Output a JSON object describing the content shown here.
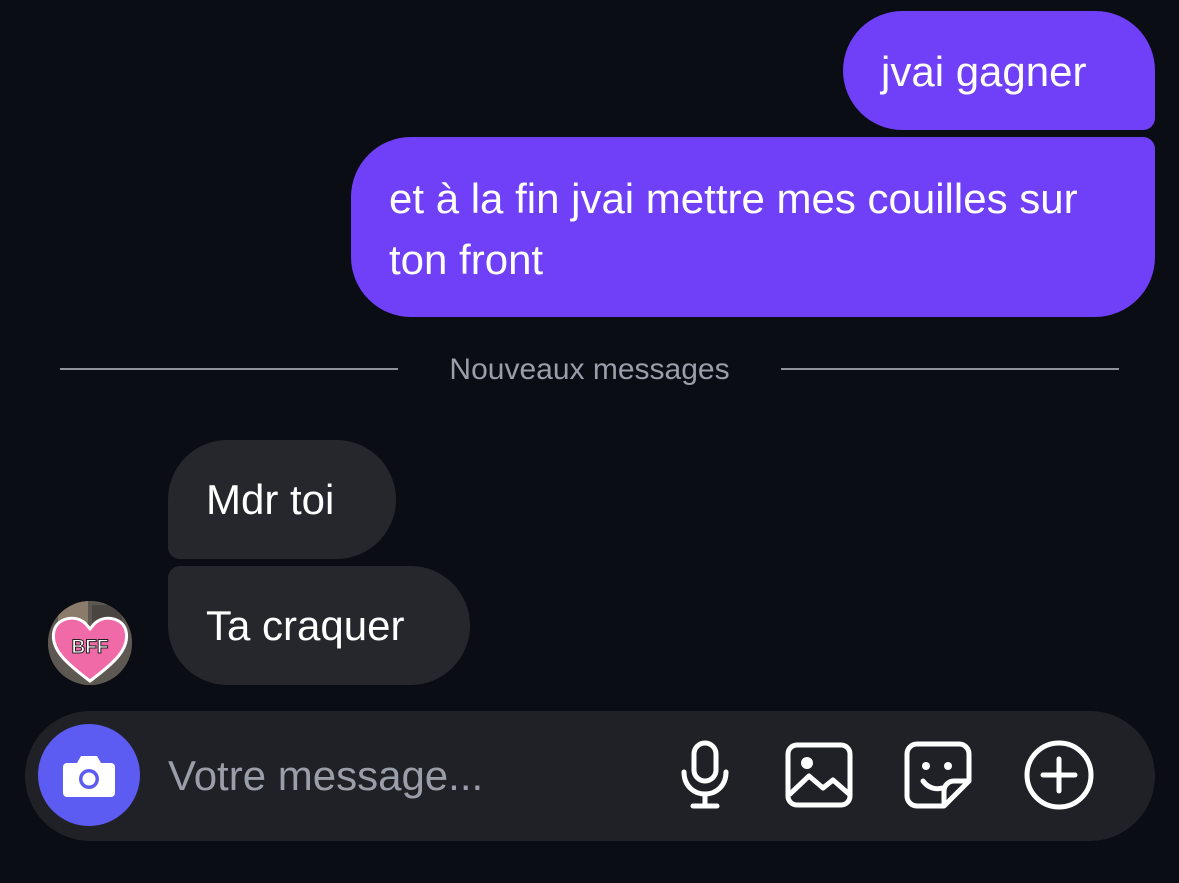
{
  "messages": {
    "sent": [
      {
        "text": "jvai gagner"
      },
      {
        "text": "et à la fin jvai mettre mes couilles sur ton front"
      }
    ],
    "divider": "Nouveaux messages",
    "received": [
      {
        "text": "Mdr toi"
      },
      {
        "text": "Ta craquer"
      }
    ]
  },
  "avatar": {
    "badge_text": "BFF",
    "badge_color": "#f06aa8"
  },
  "composer": {
    "placeholder": "Votre message...",
    "icons": [
      "camera-icon",
      "microphone-icon",
      "gallery-icon",
      "sticker-icon",
      "plus-circle-icon"
    ]
  },
  "colors": {
    "sent_bubble": "#7040f8",
    "received_bubble": "#25272d",
    "camera_button": "#5c5cf2",
    "background": "#0b0d14"
  }
}
